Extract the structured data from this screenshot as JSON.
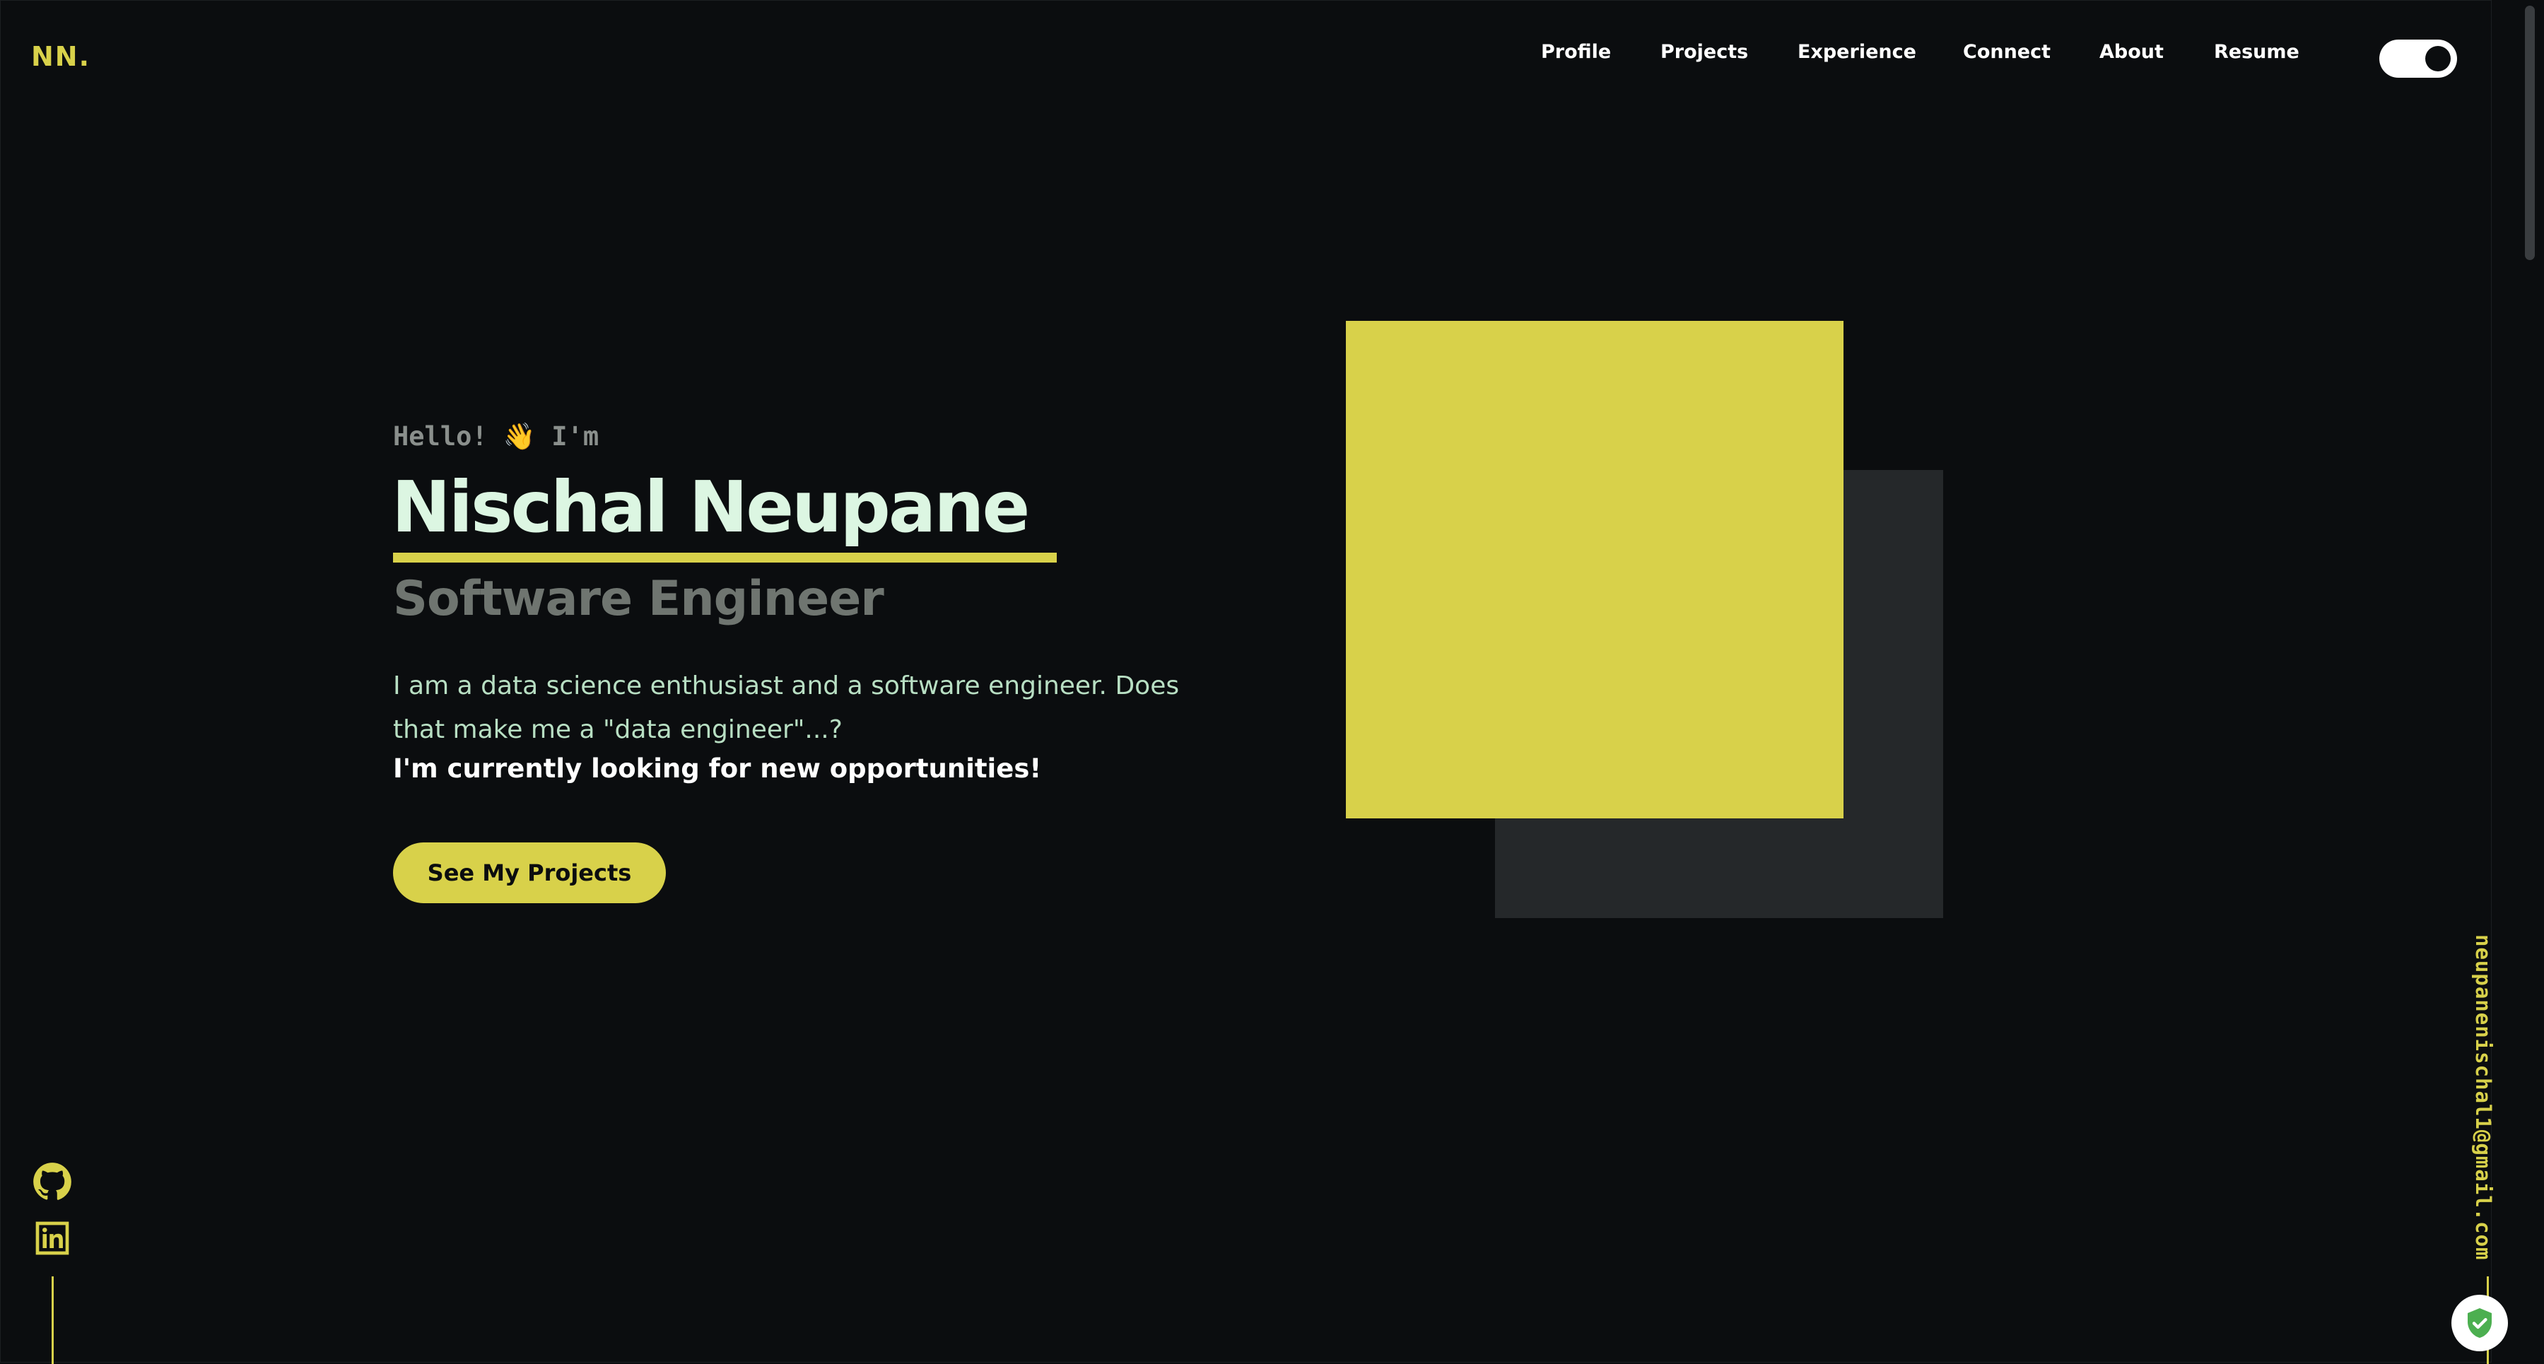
{
  "header": {
    "logo": "NN.",
    "nav": [
      "Profile",
      "Projects",
      "Experience",
      "Connect",
      "About",
      "Resume"
    ],
    "theme_toggle_on": true
  },
  "hero": {
    "greeting": "Hello! 👋 I'm",
    "name": "Nischal Neupane",
    "title": "Software Engineer",
    "description": "I am a data science enthusiast and a software engineer. Does that make me a \"data engineer\"...?",
    "status": "I'm currently looking for new opportunities!",
    "cta_label": "See My Projects"
  },
  "socials": [
    {
      "icon": "github-icon"
    },
    {
      "icon": "linkedin-icon"
    }
  ],
  "contact": {
    "email": "neupanenischal1@gmail.com"
  },
  "colors": {
    "background": "#0b0d0f",
    "accent": "#d8d14a",
    "name_text": "#dcf6e2",
    "description_text": "#b8dfc3",
    "muted_text": "#6f7570",
    "panel": "#25282a"
  }
}
